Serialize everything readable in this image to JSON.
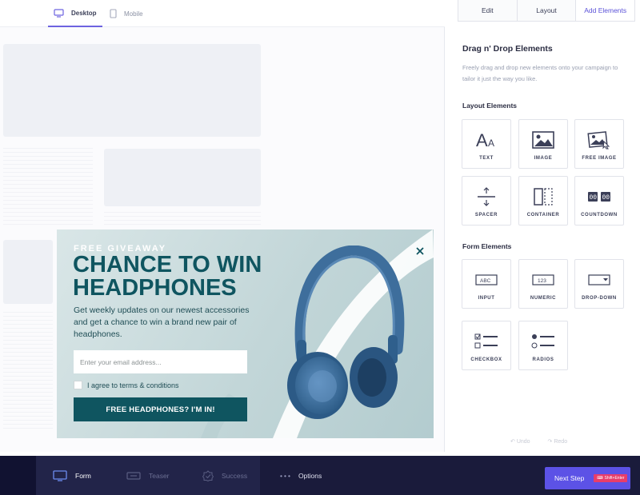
{
  "device_tabs": {
    "desktop": "Desktop",
    "mobile": "Mobile"
  },
  "popup": {
    "eyebrow": "FREE GIVEAWAY",
    "headline": "CHANCE TO WIN HEADPHONES",
    "body": "Get weekly updates on our newest accessories and get a chance to win a brand new pair of headphones.",
    "email_placeholder": "Enter your email address...",
    "agree_label": "I agree to terms & conditions",
    "cta_label": "FREE HEADPHONES? I'M IN!"
  },
  "panel": {
    "tabs": [
      "Edit",
      "Layout",
      "Add Elements"
    ],
    "active_tab": "Add Elements",
    "title": "Drag n' Drop Elements",
    "description": "Freely drag and drop new elements onto your campaign to tailor it just the way you like.",
    "layout_section_title": "Layout Elements",
    "layout_elements": [
      {
        "label": "TEXT",
        "icon": "text-icon"
      },
      {
        "label": "IMAGE",
        "icon": "image-icon"
      },
      {
        "label": "FREE IMAGE",
        "icon": "free-image-icon"
      },
      {
        "label": "SPACER",
        "icon": "spacer-icon"
      },
      {
        "label": "CONTAINER",
        "icon": "container-icon"
      },
      {
        "label": "COUNTDOWN",
        "icon": "countdown-icon"
      }
    ],
    "form_section_title": "Form Elements",
    "form_elements": [
      {
        "label": "INPUT",
        "icon": "input-icon",
        "preview": "ABC"
      },
      {
        "label": "NUMERIC",
        "icon": "numeric-icon",
        "preview": "123"
      },
      {
        "label": "DROP-DOWN",
        "icon": "dropdown-icon"
      },
      {
        "label": "CHECKBOX",
        "icon": "checkbox-icon"
      },
      {
        "label": "RADIOS",
        "icon": "radios-icon"
      }
    ],
    "undo_label": "Undo",
    "redo_label": "Redo"
  },
  "bottom_bar": {
    "steps": [
      {
        "label": "Form",
        "icon": "form-icon",
        "active": true
      },
      {
        "label": "Teaser",
        "icon": "teaser-icon",
        "active": false
      },
      {
        "label": "Success",
        "icon": "success-icon",
        "active": false
      }
    ],
    "options_label": "Options",
    "next_step_label": "Next Step",
    "shortcut_label": "Shift+Enter"
  },
  "colors": {
    "accent": "#5c52e6",
    "popup_teal": "#0f5560",
    "bottom_bar": "#1a1b3b",
    "shortcut_badge": "#e83d6a"
  }
}
